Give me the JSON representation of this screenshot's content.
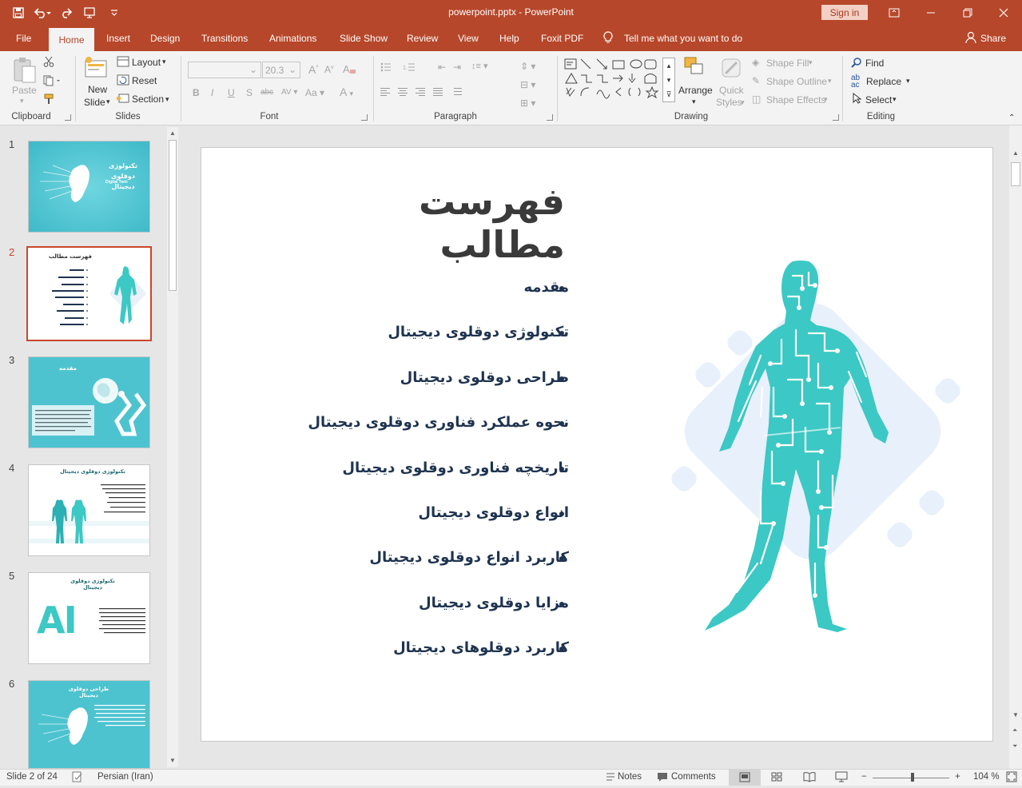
{
  "titlebar": {
    "title": "powerpoint.pptx - PowerPoint",
    "sign_in": "Sign in"
  },
  "tabs": [
    "File",
    "Home",
    "Insert",
    "Design",
    "Transitions",
    "Animations",
    "Slide Show",
    "Review",
    "View",
    "Help",
    "Foxit PDF"
  ],
  "tell_me": "Tell me what you want to do",
  "share": "Share",
  "ribbon": {
    "clipboard": {
      "paste": "Paste",
      "label": "Clipboard"
    },
    "slides": {
      "new_slide_1": "New",
      "new_slide_2": "Slide",
      "layout": "Layout",
      "reset": "Reset",
      "section": "Section",
      "label": "Slides"
    },
    "font": {
      "font_name": "",
      "font_size": "20.3",
      "label": "Font"
    },
    "paragraph": {
      "label": "Paragraph"
    },
    "drawing": {
      "arrange": "Arrange",
      "quick_styles_1": "Quick",
      "quick_styles_2": "Styles",
      "shape_fill": "Shape Fill",
      "shape_outline": "Shape Outline",
      "shape_effects": "Shape Effects",
      "label": "Drawing"
    },
    "editing": {
      "find": "Find",
      "replace": "Replace",
      "select": "Select",
      "label": "Editing"
    }
  },
  "thumbnails": [
    {
      "num": "1",
      "title": "تکنولوژی دوقلوی دیجیتال",
      "subtitle": "Digital Twin"
    },
    {
      "num": "2",
      "title": "فهرست مطالب"
    },
    {
      "num": "3",
      "title": "مقدمه"
    },
    {
      "num": "4",
      "title": "تکنولوژی دوقلوی دیجیتال"
    },
    {
      "num": "5",
      "title": "تکنولوژی دوقلوی دیجیتال",
      "big_text": "AI"
    },
    {
      "num": "6",
      "title": "طراحی دوقلوی دیجیتال"
    }
  ],
  "slide": {
    "title": "فهرست مطالب",
    "bullets": [
      "مقدمه",
      "تکنولوژی دوقلوی دیجیتال",
      "طراحی دوقلوی دیجیتال",
      "نحوه عملکرد فناوری دوقلوی دیجیتال",
      "تاریخچه فناوری دوقلوی دیجیتال",
      "انواع دوقلوی دیجیتال",
      "کاربرد انواع دوقلوی دیجیتال",
      "مزایا دوقلوی دیجیتال",
      "کاربرد دوقلوهای دیجیتال"
    ]
  },
  "status": {
    "slide_info": "Slide 2 of 24",
    "language": "Persian (Iran)",
    "notes": "Notes",
    "comments": "Comments",
    "zoom": "104 %",
    "zoom_level": 0.52
  },
  "colors": {
    "accent": "#b7472a",
    "teal": "#3cc8c4",
    "navy": "#1e3350"
  }
}
